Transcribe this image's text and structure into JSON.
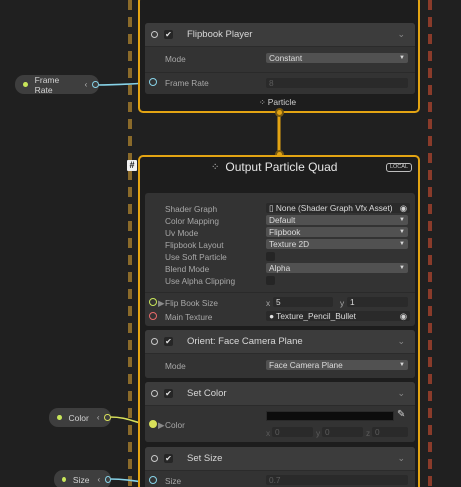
{
  "flipbook_player": {
    "title": "Flipbook Player",
    "mode_label": "Mode",
    "mode_value": "Constant",
    "frame_rate_label": "Frame Rate",
    "frame_rate_value": "8"
  },
  "particle_port_label": "Particle",
  "output_context": {
    "title": "Output Particle Quad",
    "badge": "LOCAL",
    "hash_icon": "#",
    "props": [
      {
        "label": "Shader Graph",
        "value": "None (Shader Graph Vfx Asset)"
      },
      {
        "label": "Color Mapping",
        "value": "Default"
      },
      {
        "label": "Uv Mode",
        "value": "Flipbook"
      },
      {
        "label": "Flipbook Layout",
        "value": "Texture 2D"
      },
      {
        "label": "Use Soft Particle",
        "value": ""
      },
      {
        "label": "Blend Mode",
        "value": "Alpha"
      },
      {
        "label": "Use Alpha Clipping",
        "value": ""
      }
    ],
    "flip_book_size": {
      "label": "Flip Book Size",
      "x_label": "x",
      "x_value": "5",
      "y_label": "y",
      "y_value": "1"
    },
    "main_texture": {
      "label": "Main Texture",
      "value": "Texture_Pencil_Bullet"
    }
  },
  "orient_block": {
    "title": "Orient: Face Camera Plane",
    "mode_label": "Mode",
    "mode_value": "Face Camera Plane"
  },
  "set_color_block": {
    "title": "Set Color",
    "color_label": "Color",
    "x_label": "x",
    "x_value": "0",
    "y_label": "y",
    "y_value": "0",
    "z_label": "z",
    "z_value": "0"
  },
  "set_size_block": {
    "title": "Set Size",
    "size_label": "Size",
    "size_value": "0.7"
  },
  "property_nodes": [
    {
      "name": "Frame Rate",
      "dot_color": "#c8e65a"
    },
    {
      "name": "Color",
      "dot_color": "#c8e65a"
    },
    {
      "name": "Size",
      "dot_color": "#c8e65a"
    }
  ],
  "colors": {
    "context_border": "#e3a413",
    "float_wire": "#87d3e8",
    "vec_wire": "#d8e05a"
  }
}
